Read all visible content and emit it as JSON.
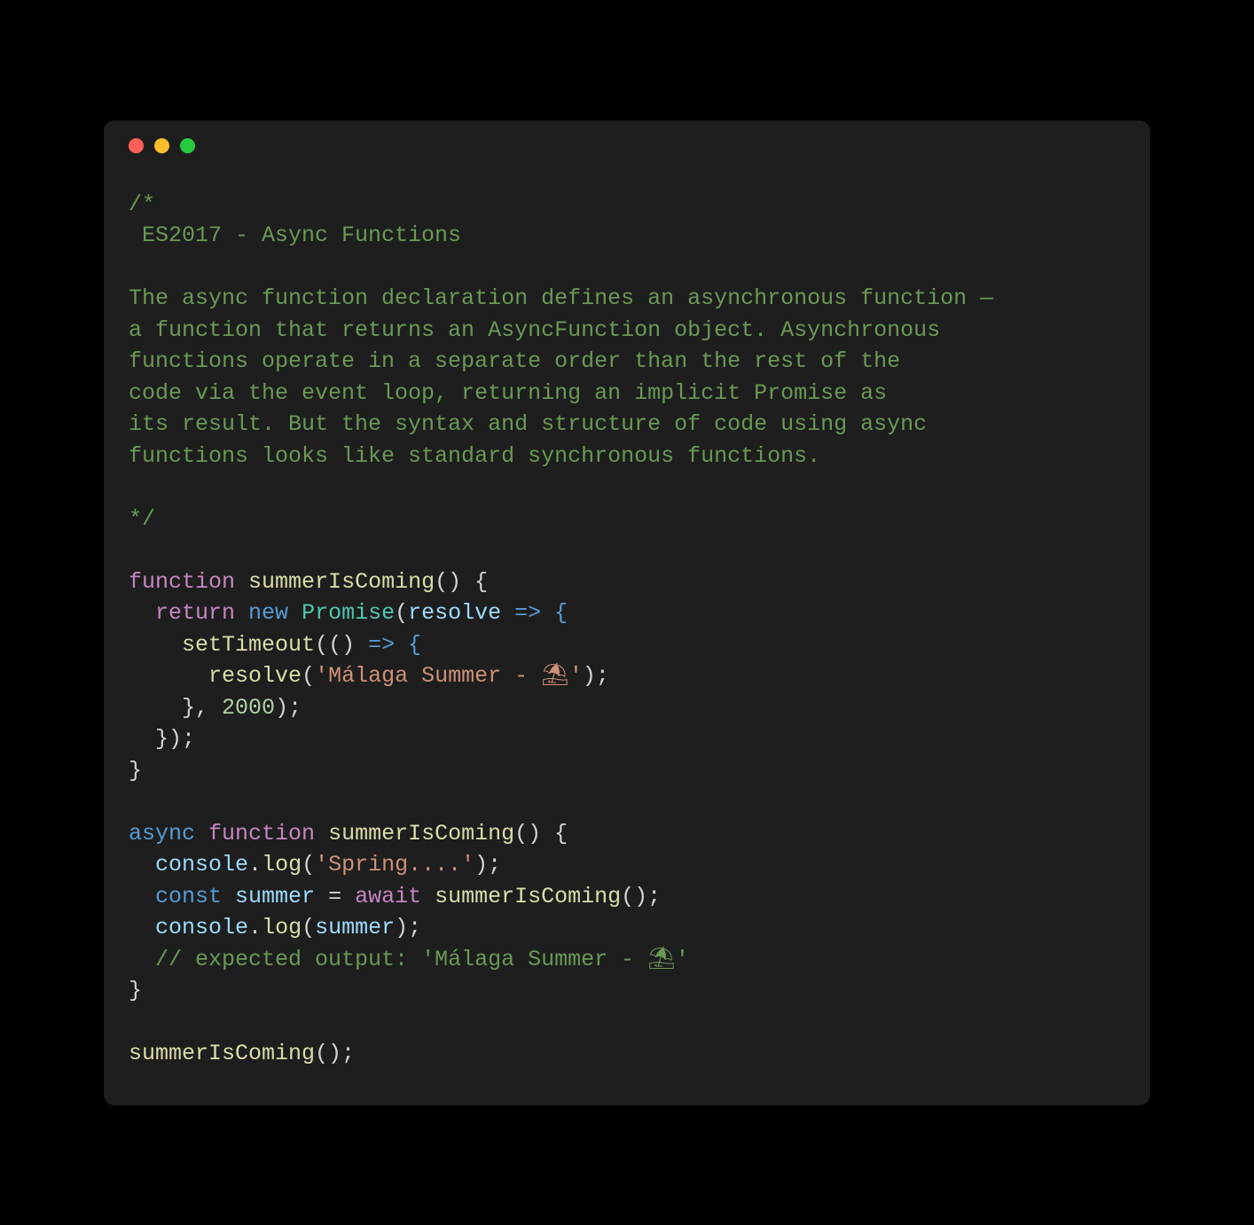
{
  "window": {
    "traffic_lights": {
      "red": "close",
      "yellow": "minimize",
      "green": "zoom"
    }
  },
  "code": {
    "comment_open": "/*",
    "comment_line1": " ES2017 - Async Functions",
    "comment_blank": "",
    "comment_p1": "The async function declaration defines an asynchronous function —",
    "comment_p2": "a function that returns an AsyncFunction object. Asynchronous",
    "comment_p3": "functions operate in a separate order than the rest of the",
    "comment_p4": "code via the event loop, returning an implicit Promise as",
    "comment_p5": "its result. But the syntax and structure of code using async",
    "comment_p6": "functions looks like standard synchronous functions.",
    "comment_close": "*/",
    "kw_function": "function",
    "fn_summerIsComing": "summerIsComing",
    "punc_paren_open": "(",
    "punc_paren_close": ")",
    "punc_brace_open": " {",
    "punc_brace_close": "}",
    "kw_return": "return",
    "kw_new": "new",
    "cls_Promise": "Promise",
    "var_resolve": "resolve",
    "arrow": " => {",
    "fn_setTimeout": "setTimeout",
    "fn_resolve_call": "resolve",
    "str_malaga": "'Málaga Summer - ⛱'",
    "punc_close_call": ");",
    "punc_comma_sp": ", ",
    "num_2000": "2000",
    "punc_close_inv": ");",
    "punc_close_prom": "});",
    "kw_async": "async",
    "obj_console": "console",
    "dot": ".",
    "fn_log": "log",
    "str_spring": "'Spring....'",
    "kw_const": "const",
    "var_summer": "summer",
    "eq": " = ",
    "kw_await": "await",
    "fn_summerIsComing_call": "summerIsComing",
    "punc_empty_args": "();",
    "var_summer_use": "summer",
    "comment_expected": "// expected output: 'Málaga Summer - ⛱'",
    "final_call": "summerIsComing",
    "semicolon": ";"
  }
}
